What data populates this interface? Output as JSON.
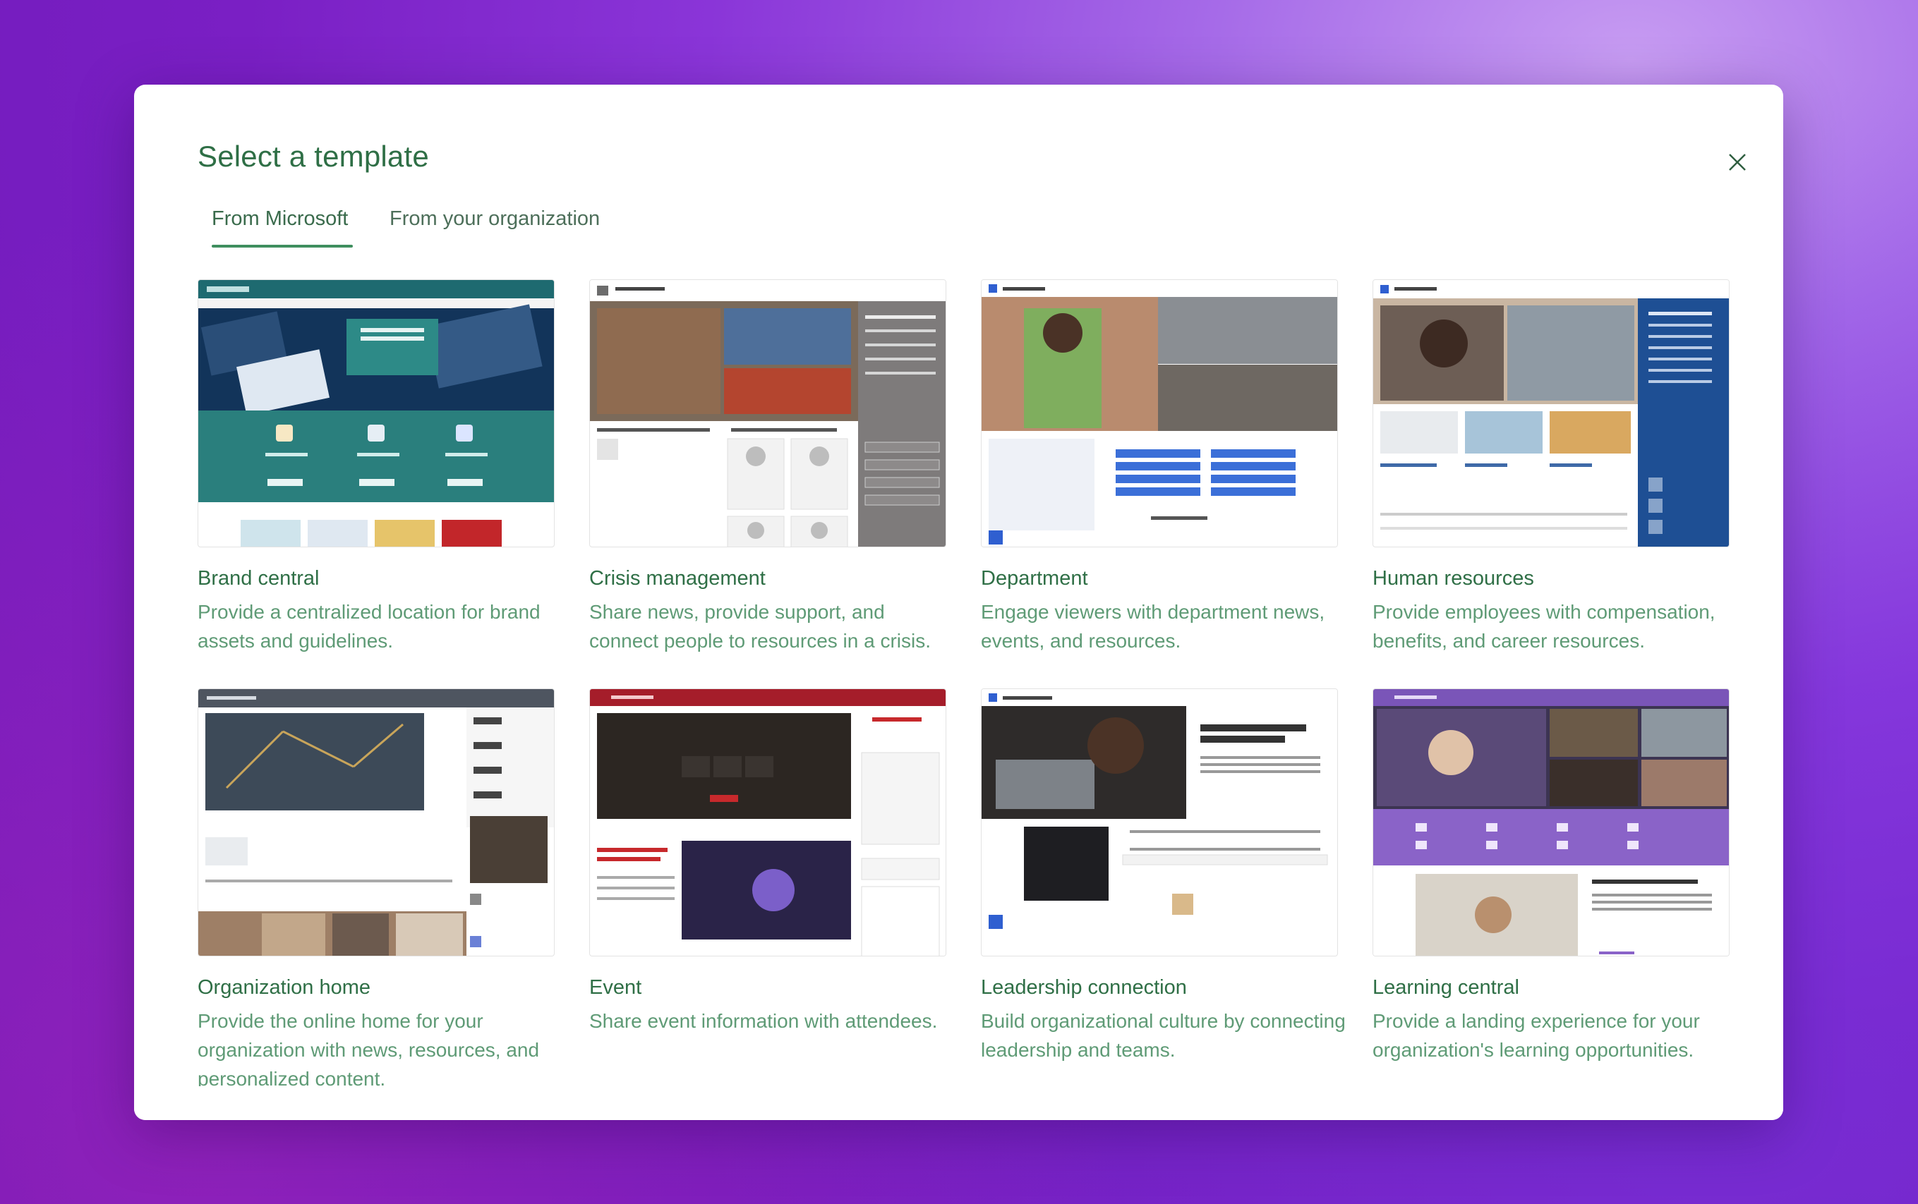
{
  "dialog": {
    "title": "Select a template",
    "close_icon": "close-icon"
  },
  "tabs": [
    {
      "label": "From Microsoft",
      "selected": true
    },
    {
      "label": "From your organization",
      "selected": false
    }
  ],
  "colors": {
    "title_green": "#2f6f46",
    "desc_green": "#5f9b76",
    "accent": "#3f8f5e"
  },
  "templates": [
    {
      "title": "Brand central",
      "description": "Provide a centralized location for brand assets and guidelines."
    },
    {
      "title": "Crisis management",
      "description": "Share news, provide support, and connect people to resources in a crisis."
    },
    {
      "title": "Department",
      "description": "Engage viewers with department news, events, and resources."
    },
    {
      "title": "Human resources",
      "description": "Provide employees with compensation, benefits, and career resources."
    },
    {
      "title": "Organization home",
      "description": "Provide the online home for your organization with news, resources, and personalized content."
    },
    {
      "title": "Event",
      "description": "Share event information with attendees."
    },
    {
      "title": "Leadership connection",
      "description": "Build organizational culture by connecting leadership and teams."
    },
    {
      "title": "Learning central",
      "description": "Provide a landing experience for your organization's learning opportunities."
    }
  ]
}
